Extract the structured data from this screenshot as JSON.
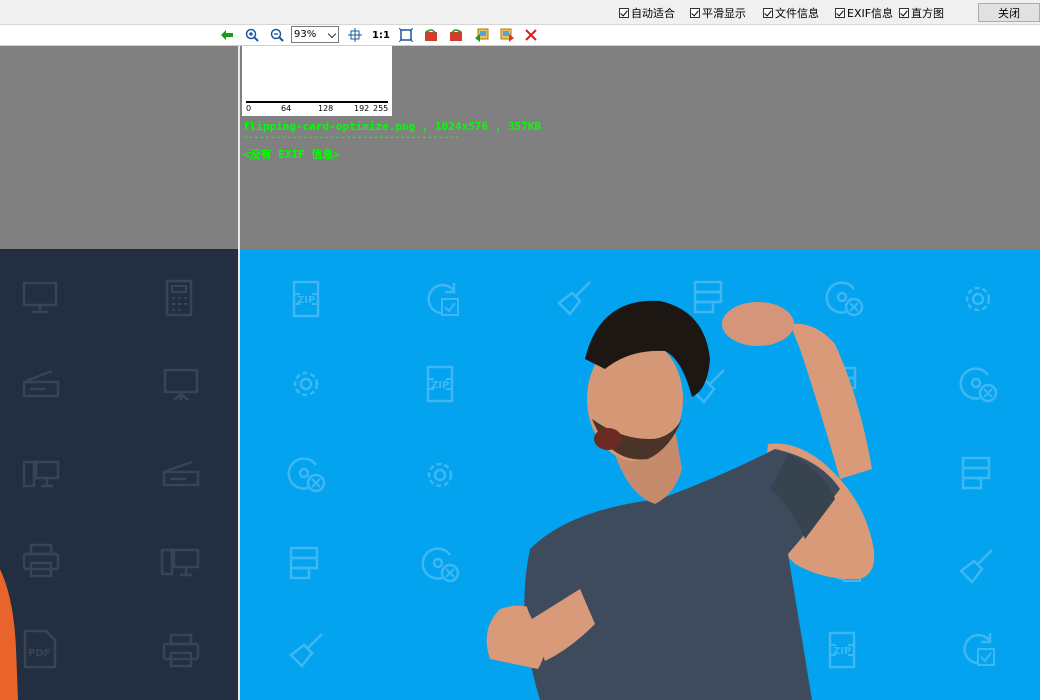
{
  "options": [
    {
      "label": "自动适合",
      "checked": true
    },
    {
      "label": "平滑显示",
      "checked": true
    },
    {
      "label": "文件信息",
      "checked": true
    },
    {
      "label": "EXIF信息",
      "checked": true
    },
    {
      "label": "直方图",
      "checked": true
    }
  ],
  "close_label": "关闭",
  "toolbar": {
    "zoom_value": "93%",
    "actual_size_label": "1:1",
    "back_icon": "green-left-arrow-icon",
    "zoom_in_icon": "zoom-in-icon",
    "zoom_out_icon": "zoom-out-icon",
    "close_icon": "red-x-icon"
  },
  "histogram": {
    "ticks": [
      "0",
      "64",
      "128",
      "192",
      "255"
    ]
  },
  "file_info": {
    "line1": "flipping-card-optimize.png , 1024x576 , 357KB",
    "separator": "----------------------------------------",
    "exif": "<没有 EXIF 信息>"
  },
  "colors": {
    "info_text": "#00ff00",
    "viewer_bg": "#808080",
    "image_blue": "#03a3ef",
    "image_dark": "#232e40"
  }
}
